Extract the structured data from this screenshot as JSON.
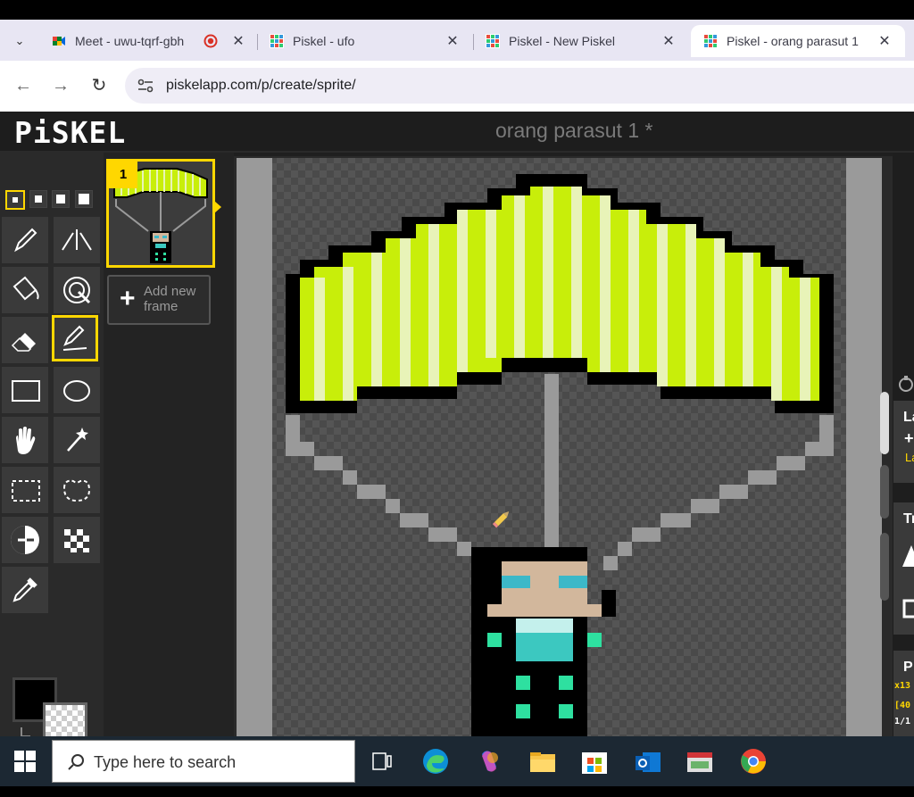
{
  "tabs": [
    {
      "title": "Meet - uwu-tqrf-gbh",
      "active": false,
      "icon": "google-meet-icon",
      "recording": true
    },
    {
      "title": "Piskel - ufo",
      "active": false,
      "icon": "piskel-icon"
    },
    {
      "title": "Piskel - New Piskel",
      "active": false,
      "icon": "piskel-icon"
    },
    {
      "title": "Piskel - orang parasut 1",
      "active": true,
      "icon": "piskel-icon"
    }
  ],
  "tab_close_glyph": "✕",
  "tab_menu_glyph": "⌄",
  "address": {
    "url": "piskelapp.com/p/create/sprite/"
  },
  "nav": {
    "back": "←",
    "forward": "→",
    "reload": "↻"
  },
  "piskel": {
    "logo": "PiSKEL",
    "sprite_name": "orang parasut 1 *",
    "frame_number": "1",
    "add_frame_label": "Add new frame",
    "add_frame_plus": "+",
    "primary_color": "#000000",
    "right_panels": [
      {
        "label": "La",
        "sub": "La"
      },
      {
        "label": "Tr"
      },
      {
        "label": "P",
        "info": [
          "x13",
          "[40",
          "1/1"
        ]
      }
    ]
  },
  "colors": {
    "canopy_yellow": "#c8ee0a",
    "canopy_light": "#e8f3b8",
    "rope_gray": "#9a9a9a",
    "skin": "#d2b79c",
    "visor": "#3cb8c8",
    "teal": "#2ee0a0",
    "body_dark": "#000000",
    "selected": "#ffd700"
  },
  "taskbar": {
    "search_placeholder": "Type here to search",
    "apps": [
      "task-view-icon",
      "edge-icon",
      "copilot-icon",
      "file-explorer-icon",
      "microsoft-store-icon",
      "outlook-icon",
      "app-icon",
      "chrome-icon"
    ]
  }
}
